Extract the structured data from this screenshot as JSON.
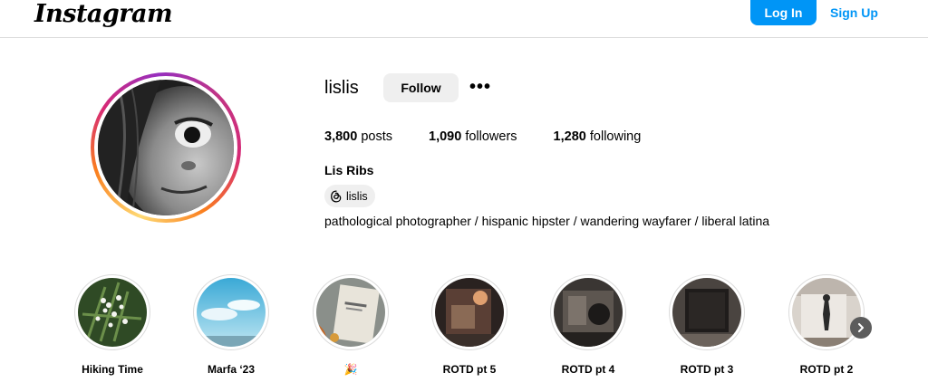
{
  "header": {
    "logo_text": "Instagram",
    "login_label": "Log In",
    "signup_label": "Sign Up"
  },
  "profile": {
    "username": "lislis",
    "follow_label": "Follow",
    "more_icon": "more-horizontal-icon",
    "stats": {
      "posts_count": "3,800",
      "posts_label": "posts",
      "followers_count": "1,090",
      "followers_label": "followers",
      "following_count": "1,280",
      "following_label": "following"
    },
    "full_name": "Lis Ribs",
    "threads_handle": "lislis",
    "bio": "pathological photographer / hispanic hipster / wandering wayfarer / liberal latina"
  },
  "highlights": [
    {
      "label": "Hiking Time"
    },
    {
      "label": "Marfa ‘23"
    },
    {
      "label": "🎉"
    },
    {
      "label": "ROTD pt 5"
    },
    {
      "label": "ROTD pt 4"
    },
    {
      "label": "ROTD pt 3"
    },
    {
      "label": "ROTD pt 2"
    }
  ],
  "colors": {
    "accent_blue": "#0095f6",
    "button_gray": "#efefef",
    "border": "#dbdbdb"
  }
}
